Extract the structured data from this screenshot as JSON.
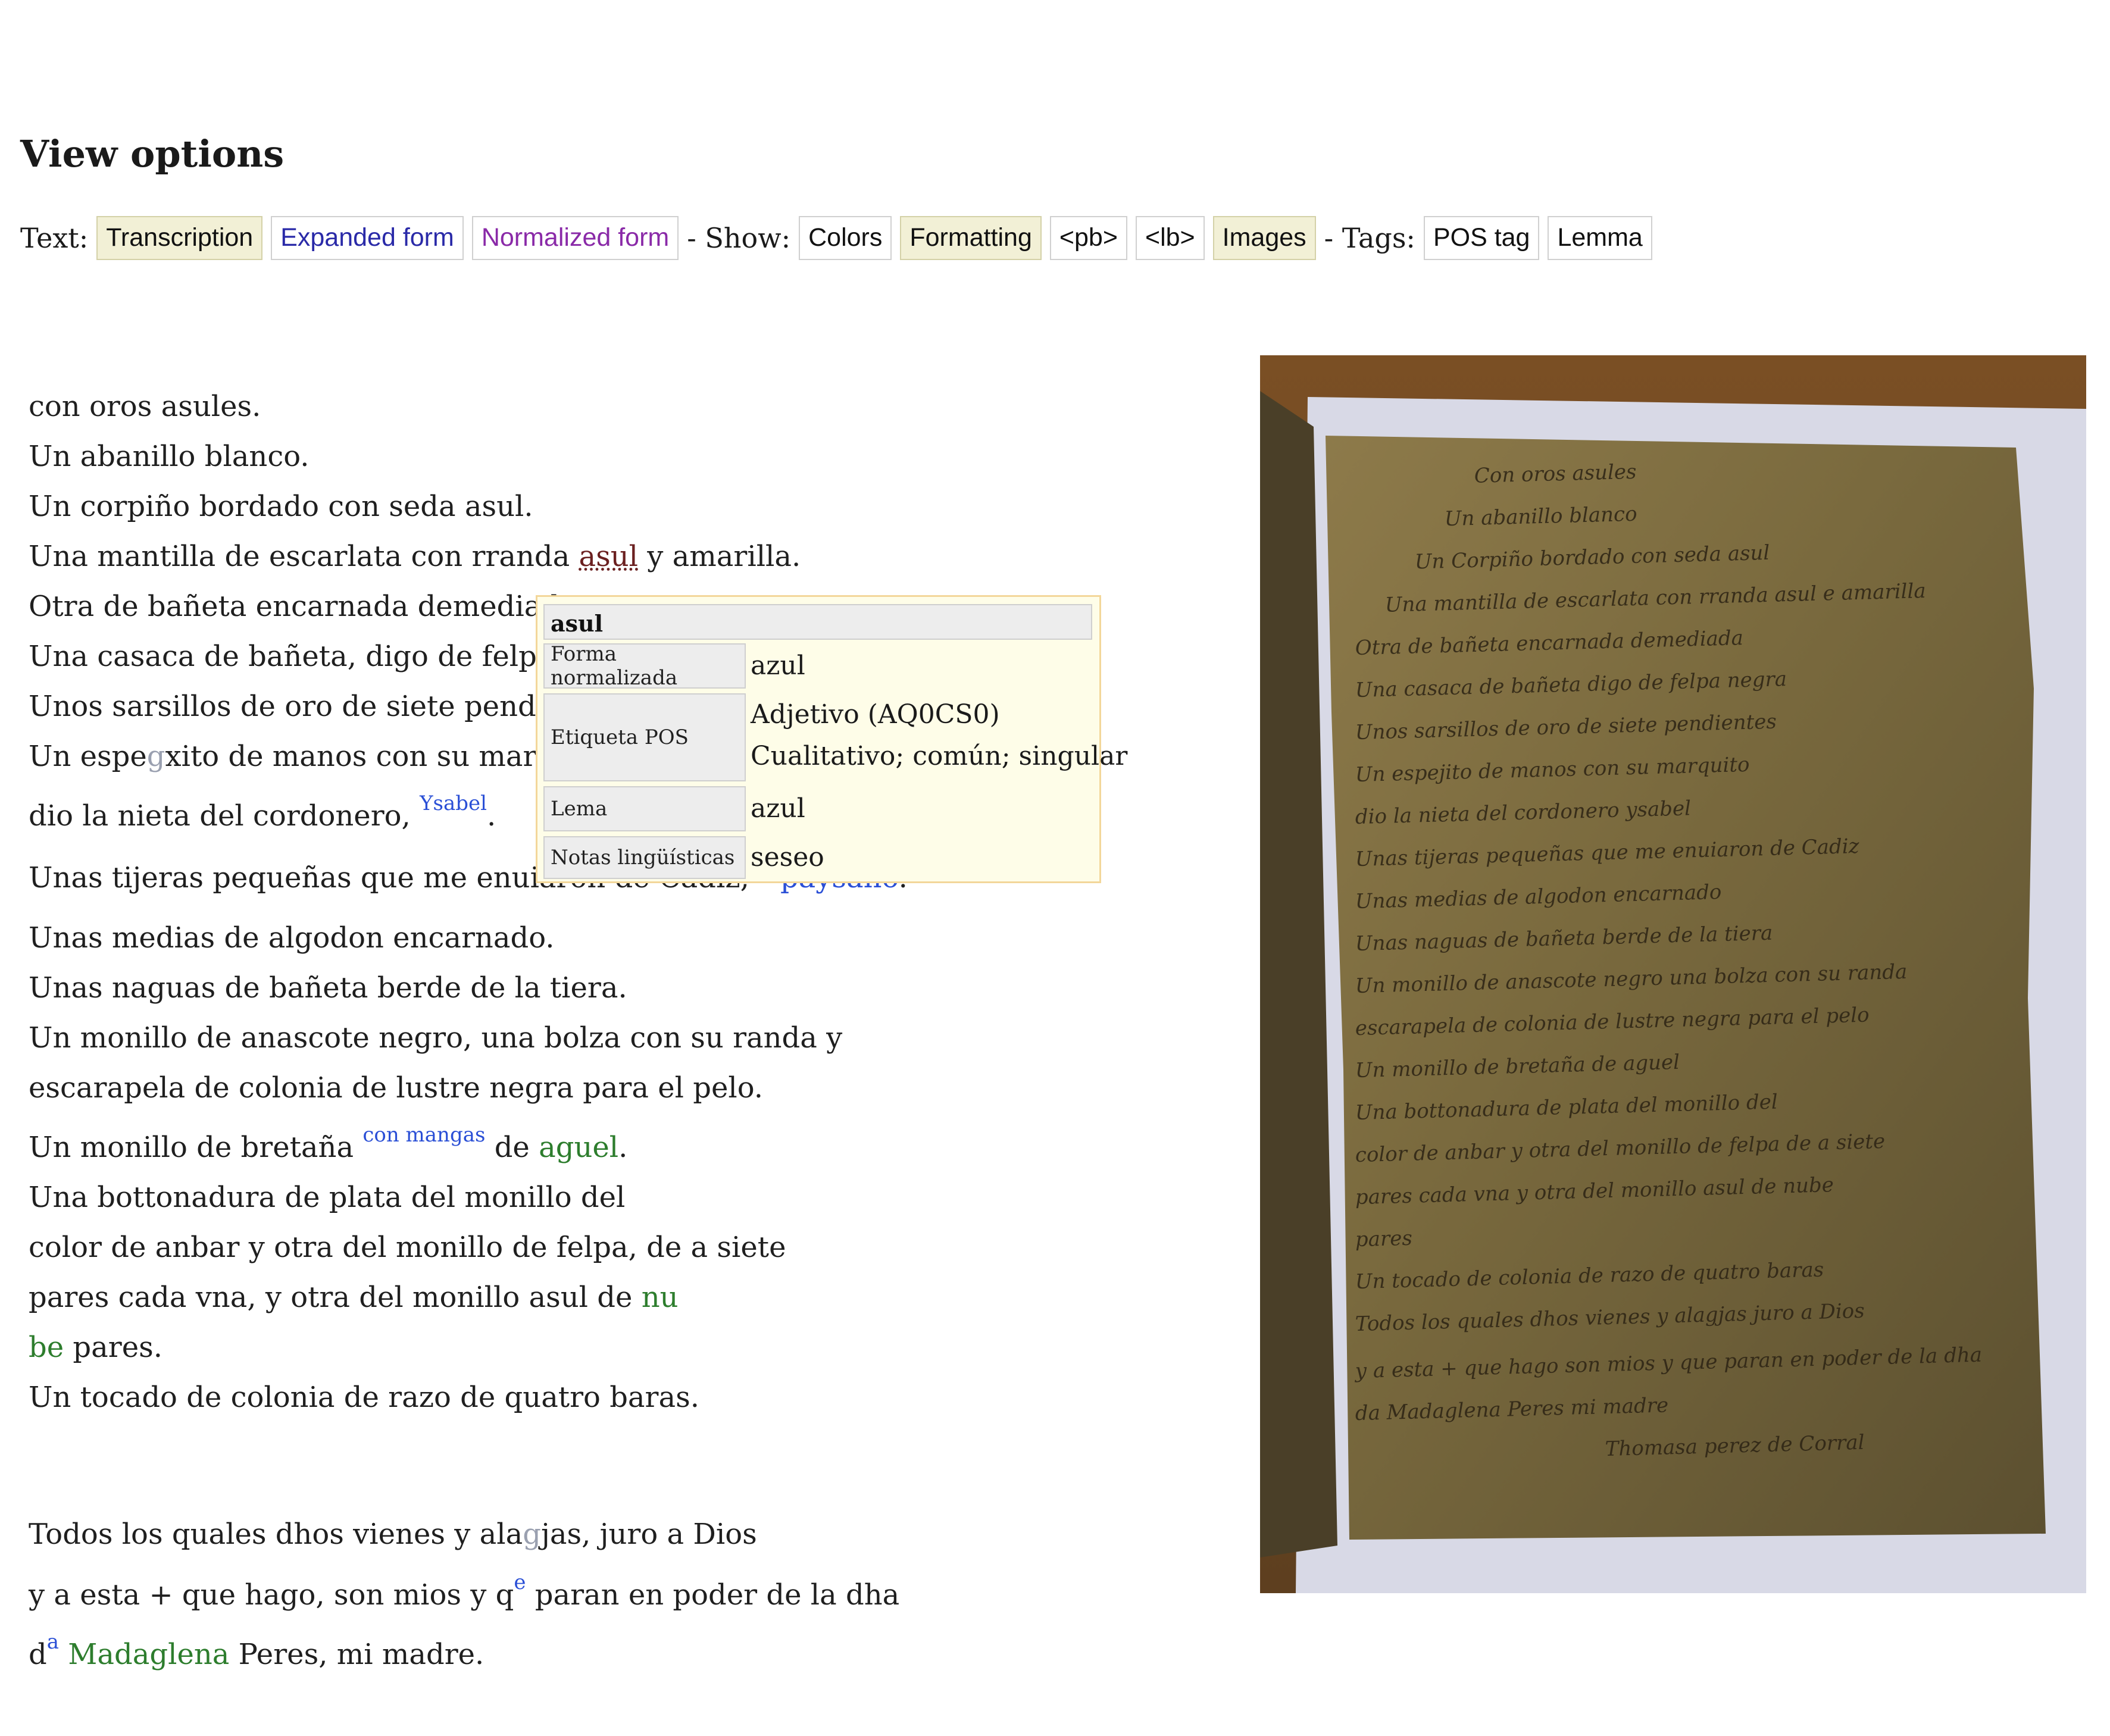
{
  "view_options": {
    "title": "View options",
    "text_label": "Text:",
    "text_buttons": [
      "Transcription",
      "Expanded form",
      "Normalized form"
    ],
    "show_label": "- Show:",
    "show_buttons": [
      "Colors",
      "Formatting",
      "<pb>",
      "<lb>",
      "Images"
    ],
    "tags_label": "- Tags:",
    "tag_buttons": [
      "POS tag",
      "Lemma"
    ],
    "active": [
      "Transcription",
      "Formatting",
      "Images"
    ]
  },
  "transcription": {
    "lines": [
      "con oros asules.",
      "Un abanillo blanco.",
      "Un corpiño bordado con seda asul.",
      "Una mantilla de escarlata con rranda ",
      "asul",
      " y amarilla.",
      "Otra de bañeta encarnada demediada.",
      "Una casaca de bañeta, digo de felpa n",
      "Unos sarsillos de oro de siete pendien",
      "Un espe",
      "g",
      "xito de manos con su marqu",
      "dio la nieta del cordonero, ",
      "Ysabel",
      ".",
      "Unas tijeras pequeñas que me enuiaron de Cadiz,",
      "paysano",
      ".",
      "Unas medias de algodon encarnado.",
      "Unas naguas de bañeta berde de la tiera.",
      "Un monillo de anascote negro, una bolza con su randa y",
      "escarapela de colonia de lustre negra para el pelo.",
      "Un monillo de bretaña ",
      "con mangas",
      " de ",
      "aguel",
      ".",
      "Una bottonadura de plata del monillo del",
      "color de anbar y otra del monillo de felpa, de a siete",
      "pares cada vna, y otra del monillo asul de ",
      "nu",
      "be",
      " pares.",
      "Un tocado de colonia de razo de quatro baras.",
      "Todos los quales dhos vienes y ala",
      "g",
      "jas, juro a Dios",
      "y a esta + que hago, son mios y q",
      "e",
      " paran en poder de la dha",
      "d",
      "a",
      " ",
      "Madaglena",
      " Peres, mi madre."
    ]
  },
  "tooltip": {
    "word": "asul",
    "rows": [
      {
        "key": "Forma normalizada",
        "value": "azul"
      },
      {
        "key": "Etiqueta POS",
        "value": "Adjetivo (AQ0CS0)",
        "value2": "Cualitativo; común; singular"
      },
      {
        "key": "Lema",
        "value": "azul"
      },
      {
        "key": "Notas lingüísticas",
        "value": "seseo"
      }
    ]
  },
  "colors": {
    "active_button_bg": "#f2f0d6",
    "expanded_text": "#2a2aa8",
    "normalized_text": "#8a2aa8",
    "name_green": "#2d7d2d",
    "addition_blue": "#2a4fd6",
    "tooltip_bg": "#fefde8",
    "tooltip_border": "#f3d79a"
  },
  "manuscript": {
    "lines": [
      "Con oros asules",
      "Un abanillo blanco",
      "Un Corpiño bordado con seda asul",
      "Una mantilla de escarlata con rranda asul e amarilla",
      "Otra de bañeta encarnada demediada",
      "Una casaca de bañeta digo de felpa negra",
      "Unos sarsillos de oro de siete pendientes",
      "Un espejito de manos con su marquito",
      "dio la nieta del cordonero ysabel",
      "Unas tijeras pequeñas que me enuiaron de Cadiz",
      "Unas medias de algodon encarnado",
      "Unas naguas de bañeta berde de la tiera",
      "Un monillo de anascote negro una bolza con su randa",
      "escarapela de colonia de lustre negra para el pelo",
      "Un monillo de bretaña de aguel",
      "Una bottonadura de plata del monillo del",
      "color de anbar y otra del monillo de felpa de a siete",
      "pares cada vna y otra del monillo asul de nube",
      "pares",
      "Un tocado de colonia de razo de quatro baras",
      "Todos los quales dhos vienes y alagjas juro a Dios",
      "y a esta + que hago son mios y que paran en poder de la dha",
      "da Madaglena Peres mi madre",
      "Thomasa perez de Corral"
    ]
  }
}
